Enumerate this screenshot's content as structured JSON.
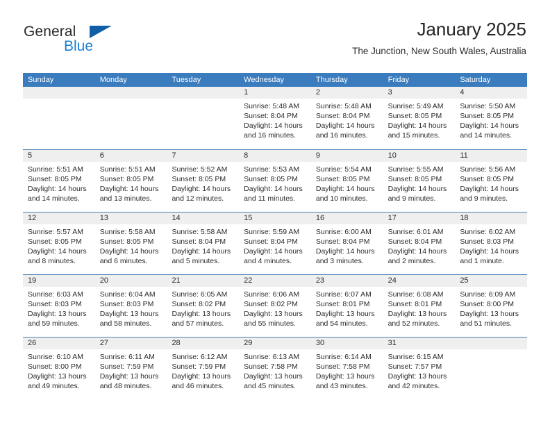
{
  "brand": {
    "name_part1": "General",
    "name_part2": "Blue",
    "triangle_icon": "triangle-logo-icon"
  },
  "header": {
    "title": "January 2025",
    "subtitle": "The Junction, New South Wales, Australia"
  },
  "colors": {
    "header_blue": "#3a7cbe",
    "week_separator": "#4a7fb0",
    "daynumber_band": "#efefef",
    "brand_blue": "#1b7fd4",
    "brand_triangle": "#115ea8",
    "text": "#2b2b2b"
  },
  "calendar": {
    "weekdays": [
      "Sunday",
      "Monday",
      "Tuesday",
      "Wednesday",
      "Thursday",
      "Friday",
      "Saturday"
    ],
    "weeks": [
      [
        {
          "day": "",
          "empty": true,
          "sunrise": "",
          "sunset": "",
          "daylight1": "",
          "daylight2": ""
        },
        {
          "day": "",
          "empty": true,
          "sunrise": "",
          "sunset": "",
          "daylight1": "",
          "daylight2": ""
        },
        {
          "day": "",
          "empty": true,
          "sunrise": "",
          "sunset": "",
          "daylight1": "",
          "daylight2": ""
        },
        {
          "day": "1",
          "empty": false,
          "sunrise": "Sunrise: 5:48 AM",
          "sunset": "Sunset: 8:04 PM",
          "daylight1": "Daylight: 14 hours",
          "daylight2": "and 16 minutes."
        },
        {
          "day": "2",
          "empty": false,
          "sunrise": "Sunrise: 5:48 AM",
          "sunset": "Sunset: 8:04 PM",
          "daylight1": "Daylight: 14 hours",
          "daylight2": "and 16 minutes."
        },
        {
          "day": "3",
          "empty": false,
          "sunrise": "Sunrise: 5:49 AM",
          "sunset": "Sunset: 8:05 PM",
          "daylight1": "Daylight: 14 hours",
          "daylight2": "and 15 minutes."
        },
        {
          "day": "4",
          "empty": false,
          "sunrise": "Sunrise: 5:50 AM",
          "sunset": "Sunset: 8:05 PM",
          "daylight1": "Daylight: 14 hours",
          "daylight2": "and 14 minutes."
        }
      ],
      [
        {
          "day": "5",
          "empty": false,
          "sunrise": "Sunrise: 5:51 AM",
          "sunset": "Sunset: 8:05 PM",
          "daylight1": "Daylight: 14 hours",
          "daylight2": "and 14 minutes."
        },
        {
          "day": "6",
          "empty": false,
          "sunrise": "Sunrise: 5:51 AM",
          "sunset": "Sunset: 8:05 PM",
          "daylight1": "Daylight: 14 hours",
          "daylight2": "and 13 minutes."
        },
        {
          "day": "7",
          "empty": false,
          "sunrise": "Sunrise: 5:52 AM",
          "sunset": "Sunset: 8:05 PM",
          "daylight1": "Daylight: 14 hours",
          "daylight2": "and 12 minutes."
        },
        {
          "day": "8",
          "empty": false,
          "sunrise": "Sunrise: 5:53 AM",
          "sunset": "Sunset: 8:05 PM",
          "daylight1": "Daylight: 14 hours",
          "daylight2": "and 11 minutes."
        },
        {
          "day": "9",
          "empty": false,
          "sunrise": "Sunrise: 5:54 AM",
          "sunset": "Sunset: 8:05 PM",
          "daylight1": "Daylight: 14 hours",
          "daylight2": "and 10 minutes."
        },
        {
          "day": "10",
          "empty": false,
          "sunrise": "Sunrise: 5:55 AM",
          "sunset": "Sunset: 8:05 PM",
          "daylight1": "Daylight: 14 hours",
          "daylight2": "and 9 minutes."
        },
        {
          "day": "11",
          "empty": false,
          "sunrise": "Sunrise: 5:56 AM",
          "sunset": "Sunset: 8:05 PM",
          "daylight1": "Daylight: 14 hours",
          "daylight2": "and 9 minutes."
        }
      ],
      [
        {
          "day": "12",
          "empty": false,
          "sunrise": "Sunrise: 5:57 AM",
          "sunset": "Sunset: 8:05 PM",
          "daylight1": "Daylight: 14 hours",
          "daylight2": "and 8 minutes."
        },
        {
          "day": "13",
          "empty": false,
          "sunrise": "Sunrise: 5:58 AM",
          "sunset": "Sunset: 8:05 PM",
          "daylight1": "Daylight: 14 hours",
          "daylight2": "and 6 minutes."
        },
        {
          "day": "14",
          "empty": false,
          "sunrise": "Sunrise: 5:58 AM",
          "sunset": "Sunset: 8:04 PM",
          "daylight1": "Daylight: 14 hours",
          "daylight2": "and 5 minutes."
        },
        {
          "day": "15",
          "empty": false,
          "sunrise": "Sunrise: 5:59 AM",
          "sunset": "Sunset: 8:04 PM",
          "daylight1": "Daylight: 14 hours",
          "daylight2": "and 4 minutes."
        },
        {
          "day": "16",
          "empty": false,
          "sunrise": "Sunrise: 6:00 AM",
          "sunset": "Sunset: 8:04 PM",
          "daylight1": "Daylight: 14 hours",
          "daylight2": "and 3 minutes."
        },
        {
          "day": "17",
          "empty": false,
          "sunrise": "Sunrise: 6:01 AM",
          "sunset": "Sunset: 8:04 PM",
          "daylight1": "Daylight: 14 hours",
          "daylight2": "and 2 minutes."
        },
        {
          "day": "18",
          "empty": false,
          "sunrise": "Sunrise: 6:02 AM",
          "sunset": "Sunset: 8:03 PM",
          "daylight1": "Daylight: 14 hours",
          "daylight2": "and 1 minute."
        }
      ],
      [
        {
          "day": "19",
          "empty": false,
          "sunrise": "Sunrise: 6:03 AM",
          "sunset": "Sunset: 8:03 PM",
          "daylight1": "Daylight: 13 hours",
          "daylight2": "and 59 minutes."
        },
        {
          "day": "20",
          "empty": false,
          "sunrise": "Sunrise: 6:04 AM",
          "sunset": "Sunset: 8:03 PM",
          "daylight1": "Daylight: 13 hours",
          "daylight2": "and 58 minutes."
        },
        {
          "day": "21",
          "empty": false,
          "sunrise": "Sunrise: 6:05 AM",
          "sunset": "Sunset: 8:02 PM",
          "daylight1": "Daylight: 13 hours",
          "daylight2": "and 57 minutes."
        },
        {
          "day": "22",
          "empty": false,
          "sunrise": "Sunrise: 6:06 AM",
          "sunset": "Sunset: 8:02 PM",
          "daylight1": "Daylight: 13 hours",
          "daylight2": "and 55 minutes."
        },
        {
          "day": "23",
          "empty": false,
          "sunrise": "Sunrise: 6:07 AM",
          "sunset": "Sunset: 8:01 PM",
          "daylight1": "Daylight: 13 hours",
          "daylight2": "and 54 minutes."
        },
        {
          "day": "24",
          "empty": false,
          "sunrise": "Sunrise: 6:08 AM",
          "sunset": "Sunset: 8:01 PM",
          "daylight1": "Daylight: 13 hours",
          "daylight2": "and 52 minutes."
        },
        {
          "day": "25",
          "empty": false,
          "sunrise": "Sunrise: 6:09 AM",
          "sunset": "Sunset: 8:00 PM",
          "daylight1": "Daylight: 13 hours",
          "daylight2": "and 51 minutes."
        }
      ],
      [
        {
          "day": "26",
          "empty": false,
          "sunrise": "Sunrise: 6:10 AM",
          "sunset": "Sunset: 8:00 PM",
          "daylight1": "Daylight: 13 hours",
          "daylight2": "and 49 minutes."
        },
        {
          "day": "27",
          "empty": false,
          "sunrise": "Sunrise: 6:11 AM",
          "sunset": "Sunset: 7:59 PM",
          "daylight1": "Daylight: 13 hours",
          "daylight2": "and 48 minutes."
        },
        {
          "day": "28",
          "empty": false,
          "sunrise": "Sunrise: 6:12 AM",
          "sunset": "Sunset: 7:59 PM",
          "daylight1": "Daylight: 13 hours",
          "daylight2": "and 46 minutes."
        },
        {
          "day": "29",
          "empty": false,
          "sunrise": "Sunrise: 6:13 AM",
          "sunset": "Sunset: 7:58 PM",
          "daylight1": "Daylight: 13 hours",
          "daylight2": "and 45 minutes."
        },
        {
          "day": "30",
          "empty": false,
          "sunrise": "Sunrise: 6:14 AM",
          "sunset": "Sunset: 7:58 PM",
          "daylight1": "Daylight: 13 hours",
          "daylight2": "and 43 minutes."
        },
        {
          "day": "31",
          "empty": false,
          "sunrise": "Sunrise: 6:15 AM",
          "sunset": "Sunset: 7:57 PM",
          "daylight1": "Daylight: 13 hours",
          "daylight2": "and 42 minutes."
        },
        {
          "day": "",
          "empty": true,
          "sunrise": "",
          "sunset": "",
          "daylight1": "",
          "daylight2": ""
        }
      ]
    ]
  }
}
